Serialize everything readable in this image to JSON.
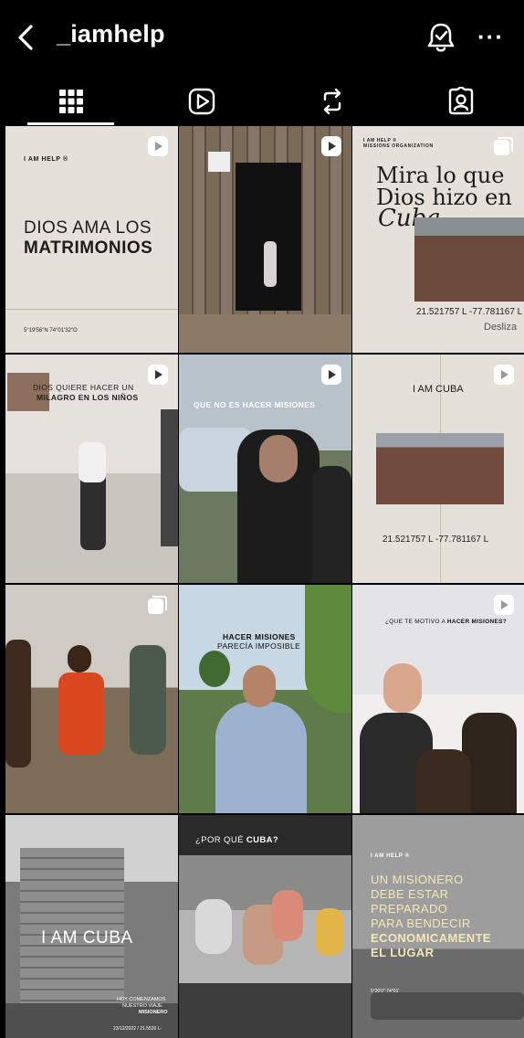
{
  "header": {
    "username": "_iamhelp"
  },
  "icons": {
    "back": "back-arrow-icon",
    "bell": "notification-bell-icon",
    "more": "more-options-icon",
    "grid": "grid-icon",
    "reels": "reels-icon",
    "reposts": "reposts-icon",
    "tagged": "tagged-icon"
  },
  "more_label": "···",
  "posts": [
    {
      "brand": "I AM HELP ®",
      "title_line1": "DIOS AMA LOS",
      "title_line2": "MATRIMONIOS",
      "coords": "5°19'56\"N 74°01'32\"O"
    },
    {},
    {
      "brand": "I AM HELP ®",
      "subbrand": "MISSIONS ORGANIZATION",
      "line1": "Mira lo que",
      "line2": "Dios hizo en",
      "line3": "Cuba",
      "coords": "21.521757 L  -77.781167 L",
      "swipe": "Desliza"
    },
    {
      "line1": "DIOS QUIERE HACER UN",
      "line2": "MILAGRO EN LOS NIÑOS"
    },
    {
      "line1": "QUE NO ES HACER MISIONES"
    },
    {
      "title": "I AM CUBA",
      "coords": "21.521757 L  -77.781167 L"
    },
    {},
    {
      "line1": "HACER MISIONES",
      "line2": "PARECÍA IMPOSIBLE"
    },
    {
      "line1_a": "¿QUE TE MOTIVO A ",
      "line1_b": "HACER MISIONES?"
    },
    {
      "title": "I AM CUBA",
      "caption1": "HOY COMENZAMOS",
      "caption2": "NUESTRO VIAJE",
      "caption3": "MISIONERO",
      "date": "23/12/2022 / 21.5520 L-"
    },
    {
      "line1_a": "¿POR QUÉ ",
      "line1_b": "CUBA?"
    },
    {
      "brand": "I AM HELP ®",
      "line1": "UN MISIONERO",
      "line2": "DEBE ESTAR",
      "line3": "PREPARADO",
      "line4": "PARA BENDECIR",
      "line5": "ECONOMICAMENTE",
      "line6": "EL LUGAR",
      "coords": "5°20'0\" 74°01'"
    }
  ],
  "colors": {
    "background": "#000000",
    "beige": "#e6e1d8",
    "text_dark": "#1c1c1c",
    "accent_gold": "#e8d28a"
  }
}
